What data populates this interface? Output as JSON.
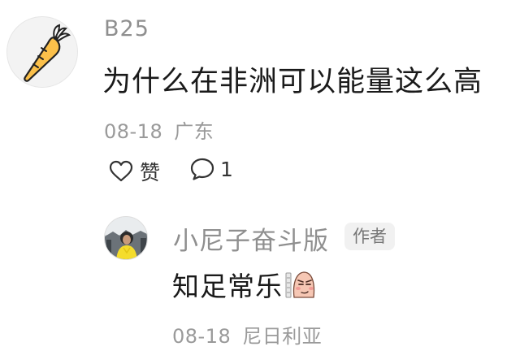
{
  "comment": {
    "username": "B25",
    "avatar_icon": "carrot-icon",
    "text": "为什么在非洲可以能量这么高",
    "date": "08-18",
    "location": "广东",
    "like_label": "赞",
    "like_icon": "heart-outline-icon",
    "reply_icon": "speech-bubble-icon",
    "reply_count": "1"
  },
  "reply": {
    "username": "小尼子奋斗版",
    "avatar_icon": "profile-photo-avatar",
    "author_badge": "作者",
    "text": "知足常乐",
    "sticker_icon": "smug-sticker-icon",
    "date": "08-18",
    "location": "尼日利亚"
  },
  "colors": {
    "primary_text": "#1a1a1a",
    "secondary_text": "#8f8f8f",
    "badge_bg": "#f1f1f1",
    "carrot_orange": "#f5a623"
  }
}
